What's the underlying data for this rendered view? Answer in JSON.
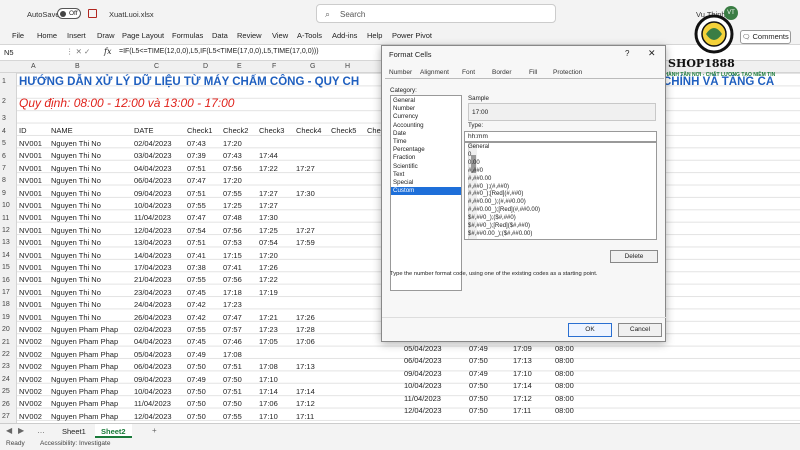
{
  "titlebar": {
    "autosave_label": "AutoSave",
    "autosave_state": "Off",
    "filename": "XuatLuoi.xlsx",
    "search_placeholder": "Search",
    "user_name": "Vu Thinh",
    "user_initials": "VT"
  },
  "menu": [
    "File",
    "Home",
    "Insert",
    "Draw",
    "Page Layout",
    "Formulas",
    "Data",
    "Review",
    "View",
    "A-Tools",
    "Add-ins",
    "Help",
    "Power Pivot"
  ],
  "comments_label": "Comments",
  "formula_bar": {
    "name_box": "N5",
    "fx": "fx",
    "formula": "=IF(L5<=TIME(12,0,0),L5,IF(L5<TIME(17,0,0),L5,TIME(17,0,0)))"
  },
  "columns": [
    "A",
    "B",
    "C",
    "D",
    "E",
    "F",
    "G",
    "H"
  ],
  "rows": [
    "1",
    "2",
    "3",
    "4",
    "5",
    "6",
    "7",
    "8",
    "9",
    "10",
    "11",
    "12",
    "13",
    "14",
    "15",
    "16",
    "17",
    "18",
    "19",
    "20",
    "21",
    "22",
    "23",
    "24",
    "25",
    "26",
    "27",
    "28"
  ],
  "sheet": {
    "title": "HƯỚNG DẪN XỬ LÝ DỮ LIỆU TỪ MÁY CHẤM CÔNG - QUY CH",
    "title_right": "CHÍNH VÀ TĂNG CA",
    "rule": "Quy định: 08:00 - 12:00 và 13:00 - 17:00",
    "headers": [
      "ID",
      "NAME",
      "DATE",
      "Check1",
      "Check2",
      "Check3",
      "Check4",
      "Check5",
      "Check"
    ]
  },
  "table_rows": [
    [
      "NV001",
      "Nguyen Thi No",
      "02/04/2023",
      "07:43",
      "17:20",
      "",
      ""
    ],
    [
      "NV001",
      "Nguyen Thi No",
      "03/04/2023",
      "07:39",
      "07:43",
      "17:44",
      ""
    ],
    [
      "NV001",
      "Nguyen Thi No",
      "04/04/2023",
      "07:51",
      "07:56",
      "17:22",
      "17:27"
    ],
    [
      "NV001",
      "Nguyen Thi No",
      "06/04/2023",
      "07:47",
      "17:20",
      "",
      ""
    ],
    [
      "NV001",
      "Nguyen Thi No",
      "09/04/2023",
      "07:51",
      "07:55",
      "17:27",
      "17:30"
    ],
    [
      "NV001",
      "Nguyen Thi No",
      "10/04/2023",
      "07:55",
      "17:25",
      "17:27",
      ""
    ],
    [
      "NV001",
      "Nguyen Thi No",
      "11/04/2023",
      "07:47",
      "07:48",
      "17:30",
      ""
    ],
    [
      "NV001",
      "Nguyen Thi No",
      "12/04/2023",
      "07:54",
      "07:56",
      "17:25",
      "17:27"
    ],
    [
      "NV001",
      "Nguyen Thi No",
      "13/04/2023",
      "07:51",
      "07:53",
      "07:54",
      "17:59"
    ],
    [
      "NV001",
      "Nguyen Thi No",
      "14/04/2023",
      "07:41",
      "17:15",
      "17:20",
      ""
    ],
    [
      "NV001",
      "Nguyen Thi No",
      "17/04/2023",
      "07:38",
      "07:41",
      "17:26",
      ""
    ],
    [
      "NV001",
      "Nguyen Thi No",
      "21/04/2023",
      "07:55",
      "07:56",
      "17:22",
      ""
    ],
    [
      "NV001",
      "Nguyen Thi No",
      "23/04/2023",
      "07:45",
      "17:18",
      "17:19",
      ""
    ],
    [
      "NV001",
      "Nguyen Thi No",
      "24/04/2023",
      "07:42",
      "17:23",
      "",
      ""
    ],
    [
      "NV001",
      "Nguyen Thi No",
      "26/04/2023",
      "07:42",
      "07:47",
      "17:21",
      "17:26"
    ],
    [
      "NV002",
      "Nguyen Pham Phap",
      "02/04/2023",
      "07:55",
      "07:57",
      "17:23",
      "17:28"
    ],
    [
      "NV002",
      "Nguyen Pham Phap",
      "04/04/2023",
      "07:45",
      "07:46",
      "17:05",
      "17:06"
    ],
    [
      "NV002",
      "Nguyen Pham Phap",
      "05/04/2023",
      "07:49",
      "17:08",
      "",
      ""
    ],
    [
      "NV002",
      "Nguyen Pham Phap",
      "06/04/2023",
      "07:50",
      "07:51",
      "17:08",
      "17:13"
    ],
    [
      "NV002",
      "Nguyen Pham Phap",
      "09/04/2023",
      "07:49",
      "07:50",
      "17:10",
      ""
    ],
    [
      "NV002",
      "Nguyen Pham Phap",
      "10/04/2023",
      "07:50",
      "07:51",
      "17:14",
      "17:14"
    ],
    [
      "NV002",
      "Nguyen Pham Phap",
      "11/04/2023",
      "07:50",
      "07:50",
      "17:06",
      "17:12"
    ],
    [
      "NV002",
      "Nguyen Pham Phap",
      "12/04/2023",
      "07:50",
      "07:55",
      "17:10",
      "17:11"
    ]
  ],
  "right_rows": [
    [
      "05/04/2023",
      "07:49",
      "17:09",
      "08:00"
    ],
    [
      "06/04/2023",
      "07:50",
      "17:13",
      "08:00"
    ],
    [
      "09/04/2023",
      "07:49",
      "17:10",
      "08:00"
    ],
    [
      "10/04/2023",
      "07:50",
      "17:14",
      "08:00"
    ],
    [
      "11/04/2023",
      "07:50",
      "17:12",
      "08:00"
    ],
    [
      "12/04/2023",
      "07:50",
      "17:11",
      "08:00"
    ]
  ],
  "sheet_tabs": [
    "Sheet1",
    "Sheet2"
  ],
  "status": {
    "ready": "Ready",
    "accessibility": "Accessibility: Investigate"
  },
  "dialog": {
    "title": "Format Cells",
    "help": "?",
    "close": "✕",
    "tabs": [
      "Number",
      "Alignment",
      "Font",
      "Border",
      "Fill",
      "Protection"
    ],
    "category_label": "Category:",
    "categories": [
      "General",
      "Number",
      "Currency",
      "Accounting",
      "Date",
      "Time",
      "Percentage",
      "Fraction",
      "Scientific",
      "Text",
      "Special",
      "Custom"
    ],
    "selected_category": "Custom",
    "sample_label": "Sample",
    "sample_value": "17:00",
    "type_label": "Type:",
    "type_value": "hh:mm",
    "codes": [
      "General",
      "0",
      "0.00",
      "#,##0",
      "#,##0.00",
      "#,##0_);(#,##0)",
      "#,##0_);[Red](#,##0)",
      "#,##0.00_);(#,##0.00)",
      "#,##0.00_);[Red](#,##0.00)",
      "$#,##0_);($#,##0)",
      "$#,##0_);[Red]($#,##0)",
      "$#,##0.00_);($#,##0.00)"
    ],
    "delete_label": "Delete",
    "hint": "Type the number format code, using one of the existing codes as a starting point.",
    "ok_label": "OK",
    "cancel_label": "Cancel"
  },
  "logo": {
    "name": "SHOP1888",
    "tagline": "BẢO HÀNH TẬN NƠI - CHẤT LƯỢNG TẠO NIỀM TIN"
  }
}
